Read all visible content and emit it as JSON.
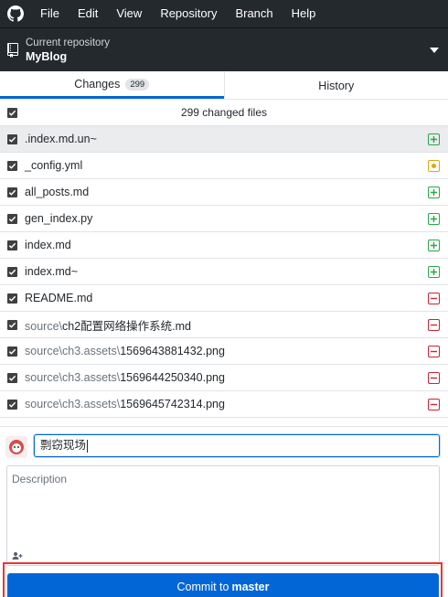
{
  "menubar": {
    "logo_icon": "github-octocat-icon",
    "items": [
      "File",
      "Edit",
      "View",
      "Repository",
      "Branch",
      "Help"
    ]
  },
  "repository": {
    "label": "Current repository",
    "name": "MyBlog",
    "icon": "repo-icon",
    "dropdown_icon": "caret-down-icon"
  },
  "tabs": {
    "changes_label": "Changes",
    "changes_count": "299",
    "history_label": "History"
  },
  "files_header": {
    "label": "299 changed files"
  },
  "files": [
    {
      "dir": "",
      "name": ".index.md.un~",
      "status": "added",
      "checked": true
    },
    {
      "dir": "",
      "name": "_config.yml",
      "status": "modified",
      "checked": true
    },
    {
      "dir": "",
      "name": "all_posts.md",
      "status": "added",
      "checked": true
    },
    {
      "dir": "",
      "name": "gen_index.py",
      "status": "added",
      "checked": true
    },
    {
      "dir": "",
      "name": "index.md",
      "status": "added",
      "checked": true
    },
    {
      "dir": "",
      "name": "index.md~",
      "status": "added",
      "checked": true
    },
    {
      "dir": "",
      "name": "README.md",
      "status": "deleted",
      "checked": true
    },
    {
      "dir": "source\\",
      "name": "ch2配置网络操作系统.md",
      "status": "deleted",
      "checked": true
    },
    {
      "dir": "source\\ch3.assets\\",
      "name": "1569643881432.png",
      "status": "deleted",
      "checked": true
    },
    {
      "dir": "source\\ch3.assets\\",
      "name": "1569644250340.png",
      "status": "deleted",
      "checked": true
    },
    {
      "dir": "source\\ch3.assets\\",
      "name": "1569645742314.png",
      "status": "deleted",
      "checked": true
    }
  ],
  "commit": {
    "summary_value": "剽窃现场",
    "description_placeholder": "Description",
    "coauthor_icon": "add-coauthor-icon",
    "button_prefix": "Commit to",
    "button_branch": "master"
  },
  "colors": {
    "menubar_bg": "#24292e",
    "accent": "#0366d6",
    "added": "#28a745",
    "modified": "#dbab09",
    "deleted": "#cb2431",
    "highlight_frame": "#ee3333"
  }
}
